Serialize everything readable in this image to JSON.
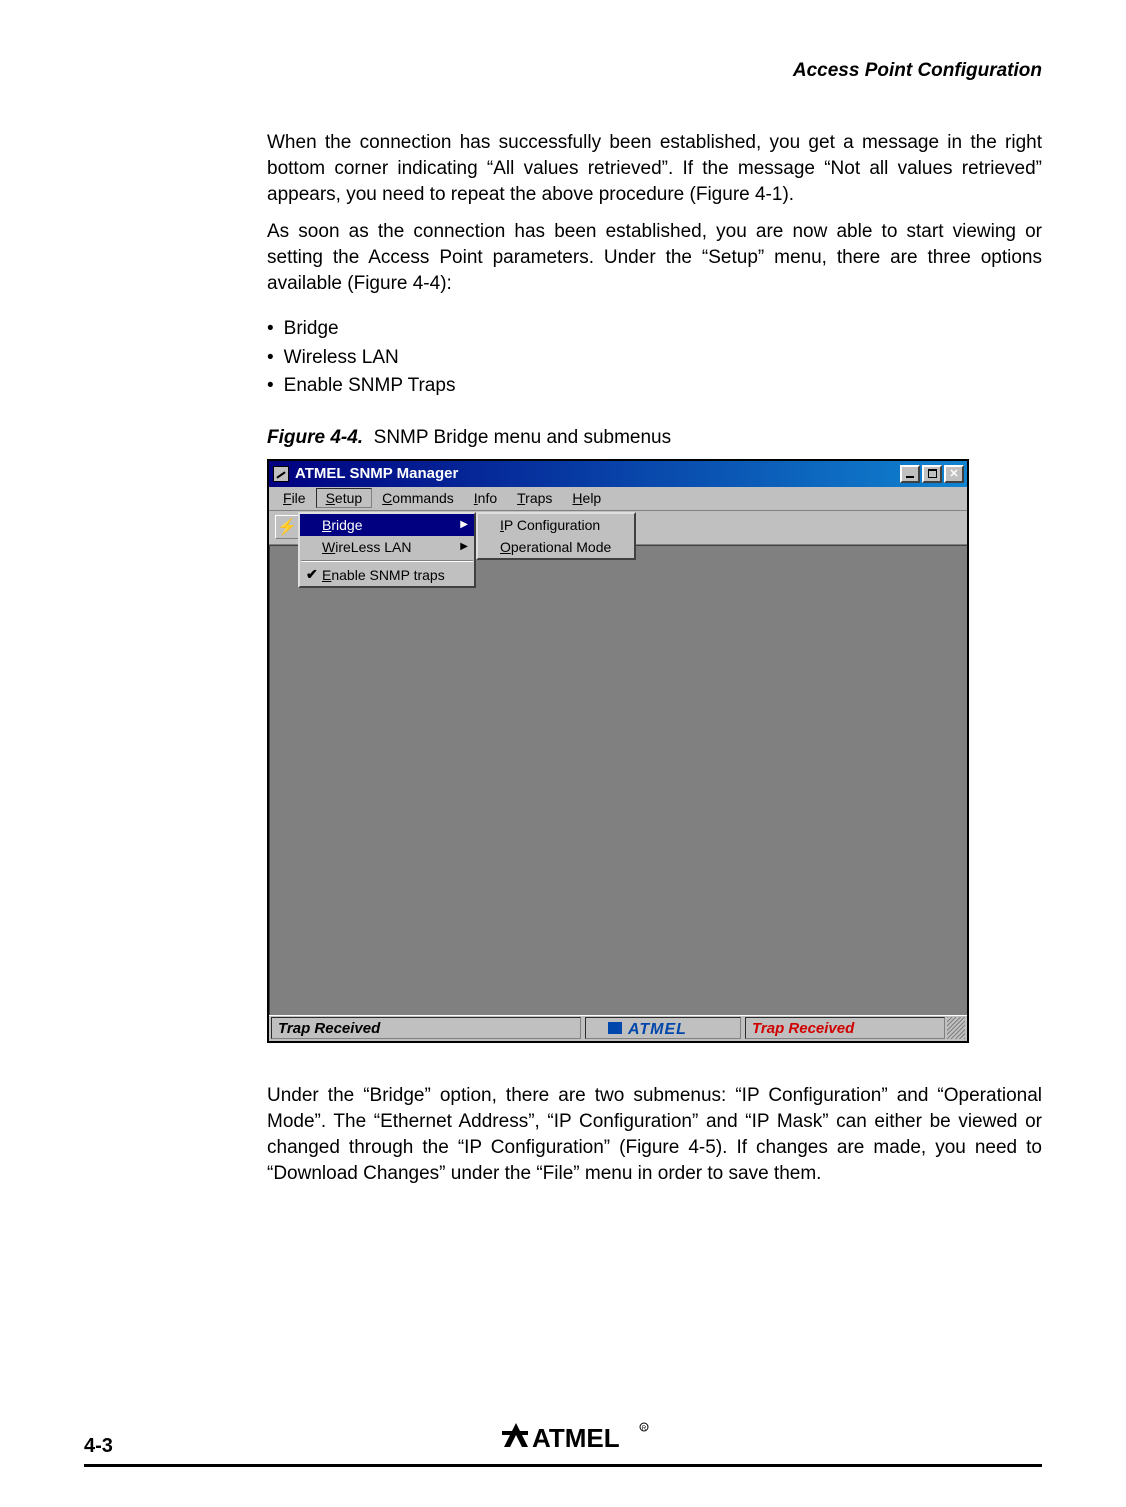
{
  "header": {
    "section_title": "Access Point Configuration"
  },
  "body": {
    "para1": "When the connection has successfully been established, you get a message in the right bottom corner indicating “All values retrieved”. If the message “Not all values retrieved” appears, you need to repeat the above procedure (Figure 4-1).",
    "para2": "As soon as the connection has been established, you are now able to start viewing or setting the Access Point parameters. Under the “Setup” menu, there are three options available (Figure 4-4):",
    "bullets": [
      "Bridge",
      "Wireless LAN",
      "Enable SNMP Traps"
    ],
    "figure": {
      "label": "Figure 4-4.",
      "caption": "SNMP Bridge menu and submenus"
    },
    "para3": "Under the “Bridge” option, there are two submenus: “IP Configuration” and “Operational Mode”. The “Ethernet Address”, “IP Configuration” and “IP Mask” can either be viewed or changed through the “IP Configuration” (Figure 4-5). If changes are made, you need to “Download Changes” under the “File” menu in order to save them."
  },
  "app": {
    "title": "ATMEL SNMP Manager",
    "menubar": {
      "file": {
        "plain": "ile",
        "u": "F"
      },
      "setup": {
        "plain": "etup",
        "u": "S"
      },
      "commands": {
        "plain": "ommands",
        "u": "C"
      },
      "info": {
        "plain": "nfo",
        "u": "I"
      },
      "traps": {
        "plain": "raps",
        "u": "T"
      },
      "help": {
        "plain": "elp",
        "u": "H"
      }
    },
    "setup_menu": {
      "bridge": {
        "u": "B",
        "plain": "ridge"
      },
      "wireless": {
        "u": "W",
        "plain": "ireLess LAN"
      },
      "enable": {
        "u": "E",
        "plain": "nable SNMP traps"
      }
    },
    "bridge_submenu": {
      "ipconf": {
        "u": "I",
        "plain": "P Configuration"
      },
      "opmode": {
        "u": "O",
        "plain": "perational Mode"
      }
    },
    "status": {
      "left": "Trap Received",
      "logo": "ATMEL",
      "right": "Trap Received"
    }
  },
  "footer": {
    "page": "4-3",
    "logo": "ATMEL"
  }
}
